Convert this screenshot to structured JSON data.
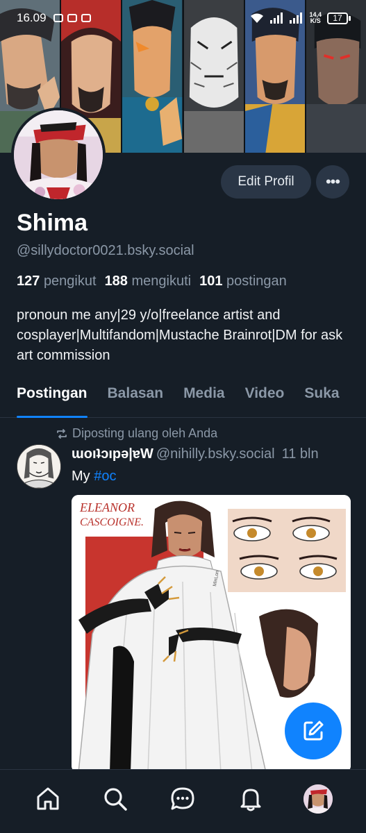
{
  "status_bar": {
    "time": "16.09",
    "speed_value": "14,4",
    "speed_unit": "K/S",
    "battery": "17"
  },
  "banner": {
    "panels": [
      "banner-panel-1",
      "banner-panel-2",
      "banner-panel-3",
      "banner-panel-4",
      "banner-panel-5",
      "banner-panel-6"
    ]
  },
  "profile": {
    "edit_label": "Edit Profil",
    "more_label": "•••",
    "display_name": "Shima",
    "handle": "@sillydoctor0021.bsky.social",
    "followers_count": "127",
    "followers_label": "pengikut",
    "following_count": "188",
    "following_label": "mengikuti",
    "posts_count": "101",
    "posts_label": "postingan",
    "bio": "pronoun me any|29 y/o|freelance artist and cosplayer|Multifandom|Mustache Brainrot|DM for ask art commission"
  },
  "tabs": [
    {
      "label": "Postingan",
      "active": true
    },
    {
      "label": "Balasan",
      "active": false
    },
    {
      "label": "Media",
      "active": false
    },
    {
      "label": "Video",
      "active": false
    },
    {
      "label": "Suka",
      "active": false
    }
  ],
  "post": {
    "repost_label": "Diposting ulang oleh Anda",
    "author": "ɯoıʇɔıpǝ|ɐW",
    "handle": "@nihilly.bsky.social",
    "time": "11 bln",
    "text_prefix": "My ",
    "hashtag": "#oc",
    "image_caption": "ELEANOR CASCOIGNE."
  },
  "bottom_nav": {
    "items": [
      "home-icon",
      "search-icon",
      "chat-icon",
      "bell-icon",
      "profile-avatar"
    ]
  },
  "colors": {
    "background": "#161e27",
    "accent": "#1083fe",
    "button_bg": "#2a3646",
    "muted_text": "#8b98a7"
  }
}
